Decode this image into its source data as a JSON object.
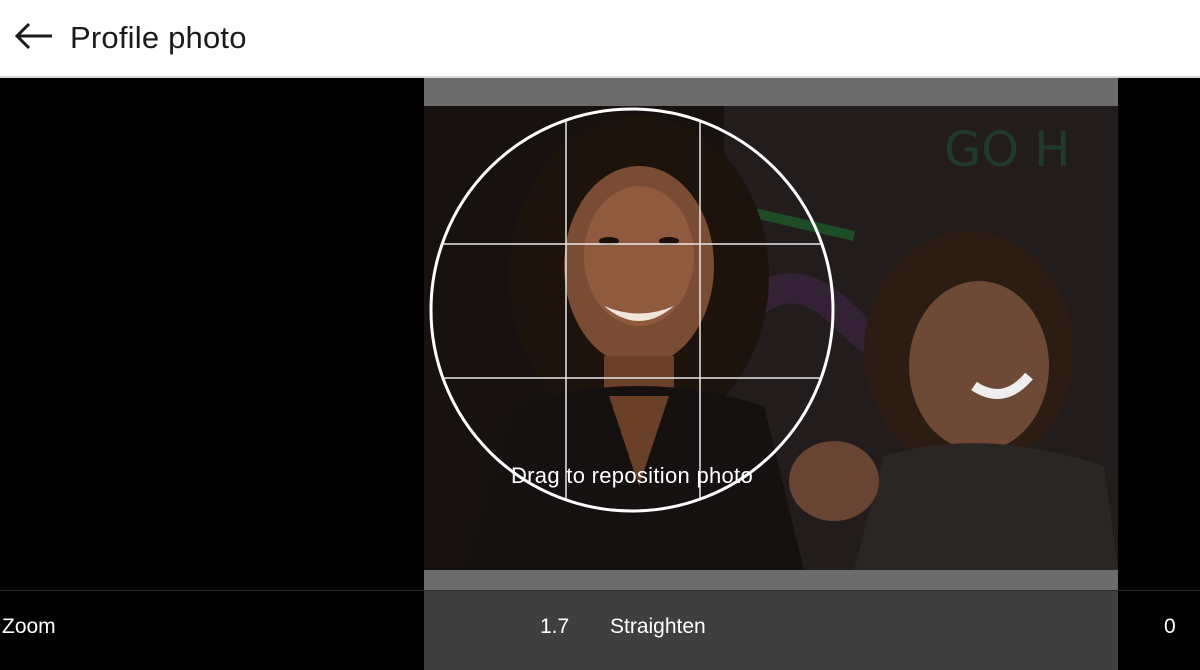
{
  "header": {
    "title": "Profile photo"
  },
  "cropper": {
    "hint": "Drag to reposition photo"
  },
  "controls": {
    "zoom_label": "Zoom",
    "zoom_value": "1.7",
    "straighten_label": "Straighten",
    "straighten_value": "0"
  }
}
